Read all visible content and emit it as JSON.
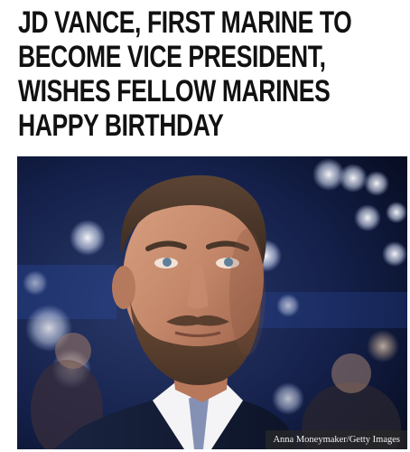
{
  "headline": {
    "lines": [
      "JD VANCE, FIRST MARINE TO",
      "BECOME VICE PRESIDENT,",
      "WISHES FELLOW MARINES",
      "HAPPY BIRTHDAY"
    ]
  },
  "photo": {
    "credit": "Anna Moneymaker/Getty Images"
  }
}
